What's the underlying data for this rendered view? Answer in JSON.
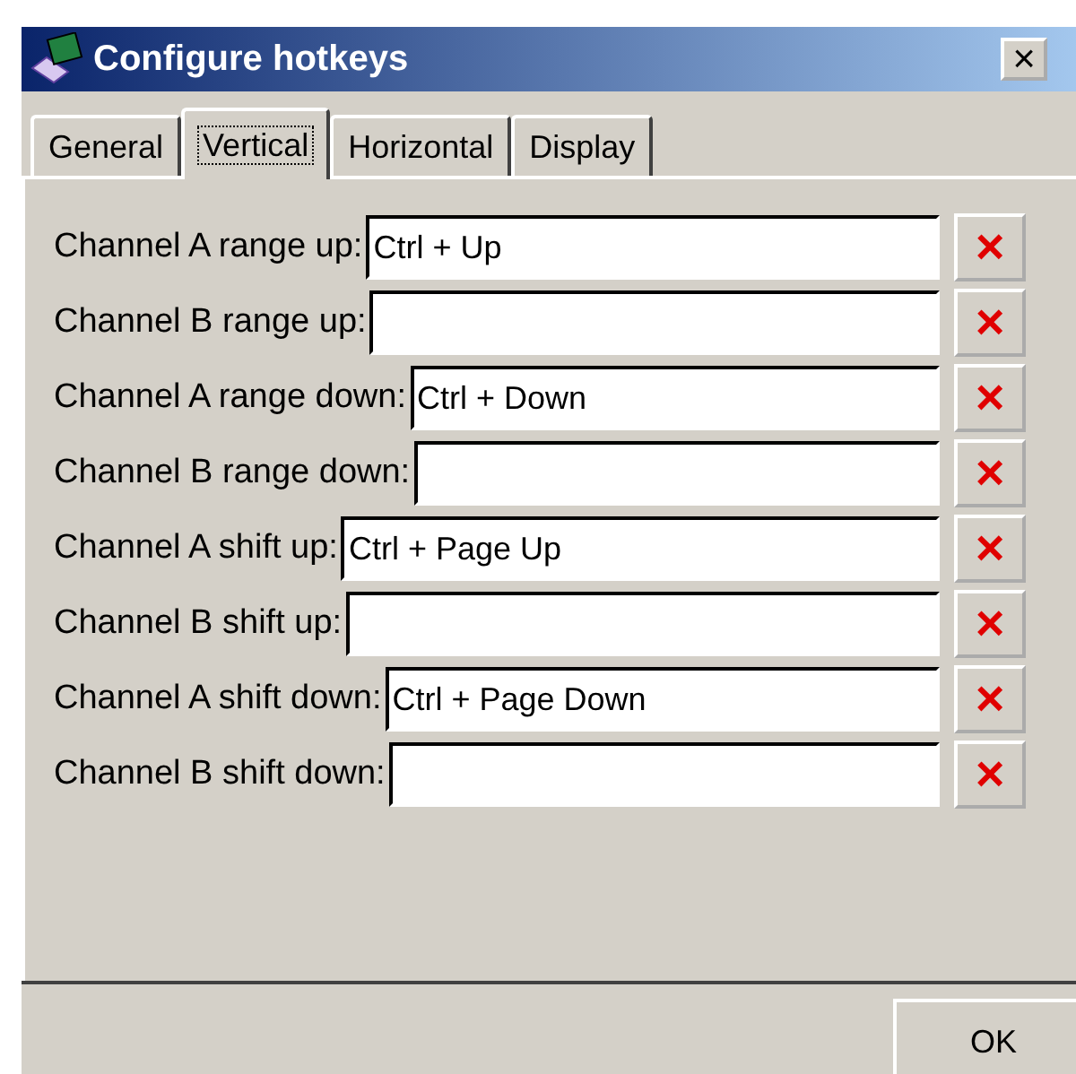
{
  "window": {
    "title": "Configure hotkeys",
    "close": "×"
  },
  "tabs": [
    {
      "label": "General",
      "selected": false
    },
    {
      "label": "Vertical",
      "selected": true
    },
    {
      "label": "Horizontal",
      "selected": false
    },
    {
      "label": "Display",
      "selected": false
    }
  ],
  "hotkeys": [
    {
      "label": "Channel A range up:",
      "value": "Ctrl + Up",
      "clear": "×"
    },
    {
      "label": "Channel B range up:",
      "clear": "×"
    },
    {
      "label": "Channel A range down:",
      "value": "Ctrl + Down",
      "clear": "×"
    },
    {
      "label": "Channel B range down:",
      "clear": "×"
    },
    {
      "label": "Channel A shift up:",
      "value": "Ctrl + Page Up",
      "clear": "×"
    },
    {
      "label": "Channel B shift up:",
      "clear": "×"
    },
    {
      "label": "Channel A shift down:",
      "value": "Ctrl + Page Down",
      "clear": "×"
    },
    {
      "label": "Channel B shift down:",
      "clear": "×"
    }
  ],
  "buttons": [
    "OK"
  ]
}
